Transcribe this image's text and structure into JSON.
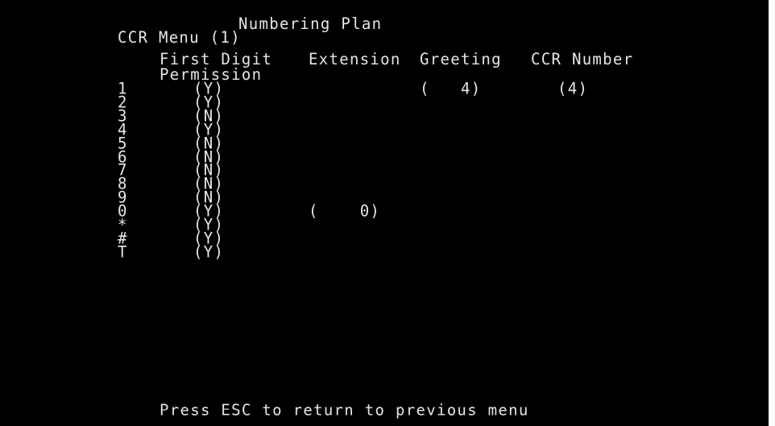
{
  "header": {
    "title": "Numbering Plan",
    "menu": "CCR Menu (1)"
  },
  "columns": {
    "first_digit": "First Digit",
    "permission": "Permission",
    "extension": "Extension",
    "greeting": "Greeting",
    "ccr_number": "CCR Number"
  },
  "rows": [
    {
      "digit": "1",
      "permission": "(Y)",
      "extension": "",
      "greeting": "(   4)",
      "ccr_number": "(4)"
    },
    {
      "digit": "2",
      "permission": "(Y)",
      "extension": "",
      "greeting": "",
      "ccr_number": ""
    },
    {
      "digit": "3",
      "permission": "(N)",
      "extension": "",
      "greeting": "",
      "ccr_number": ""
    },
    {
      "digit": "4",
      "permission": "(Y)",
      "extension": "",
      "greeting": "",
      "ccr_number": ""
    },
    {
      "digit": "5",
      "permission": "(N)",
      "extension": "",
      "greeting": "",
      "ccr_number": ""
    },
    {
      "digit": "6",
      "permission": "(N)",
      "extension": "",
      "greeting": "",
      "ccr_number": ""
    },
    {
      "digit": "7",
      "permission": "(N)",
      "extension": "",
      "greeting": "",
      "ccr_number": ""
    },
    {
      "digit": "8",
      "permission": "(N)",
      "extension": "",
      "greeting": "",
      "ccr_number": ""
    },
    {
      "digit": "9",
      "permission": "(N)",
      "extension": "",
      "greeting": "",
      "ccr_number": ""
    },
    {
      "digit": "0",
      "permission": "(Y)",
      "extension": "(    0)",
      "greeting": "",
      "ccr_number": ""
    },
    {
      "digit": "*",
      "permission": "(Y)",
      "extension": "",
      "greeting": "",
      "ccr_number": ""
    },
    {
      "digit": "#",
      "permission": "(Y)",
      "extension": "",
      "greeting": "",
      "ccr_number": ""
    },
    {
      "digit": "T",
      "permission": "(Y)",
      "extension": "",
      "greeting": "",
      "ccr_number": ""
    }
  ],
  "footer": {
    "hint": "Press ESC to return to previous menu"
  },
  "colors": {
    "background": "#000000",
    "text": "#e6e6e6"
  }
}
